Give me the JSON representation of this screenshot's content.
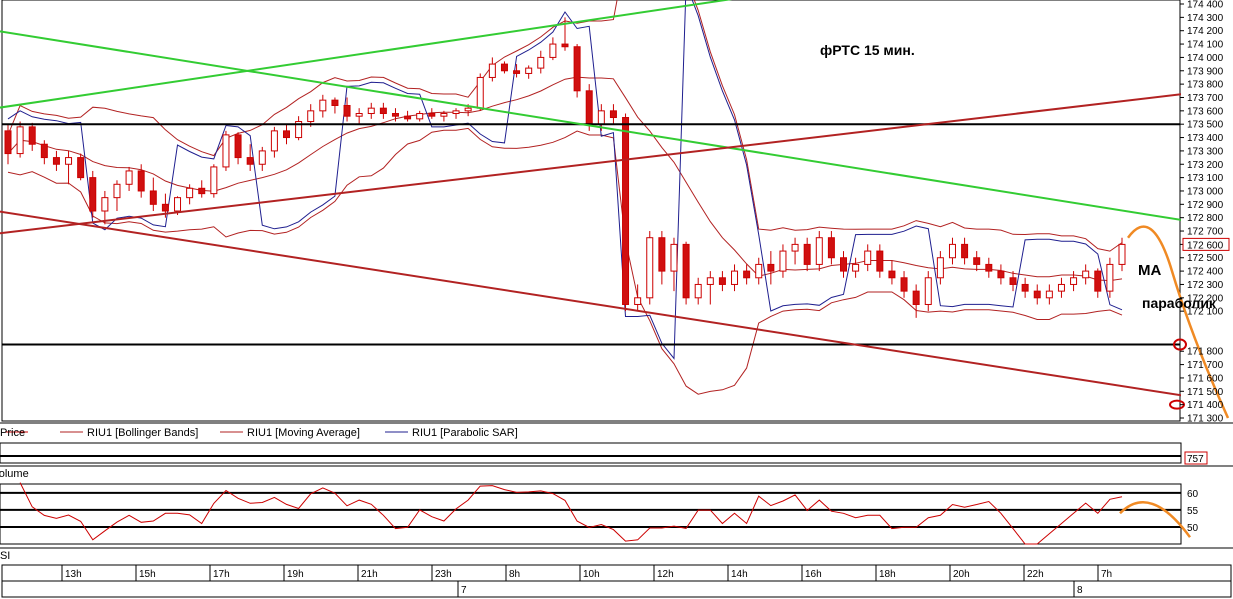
{
  "chart_data": {
    "type": "candlestick",
    "title": "фРТС   15 мин.",
    "annotations": [
      "МА",
      "параболик"
    ],
    "price_axis": {
      "ylim": [
        171300,
        174400
      ],
      "ticks": [
        "174 400",
        "174 300",
        "174 200",
        "174 100",
        "174 000",
        "173 900",
        "173 800",
        "173 700",
        "173 600",
        "173 500",
        "173 400",
        "173 300",
        "173 200",
        "173 100",
        "173 000",
        "172 900",
        "172 800",
        "172 700",
        "172 600",
        "172 500",
        "172 400",
        "172 300",
        "172 200",
        "172 100",
        "171 800",
        "171 700",
        "171 600",
        "171 500",
        "171 400",
        "171 300"
      ],
      "last_price": "172 600"
    },
    "time_axis": {
      "hour_labels": [
        "13h",
        "15h",
        "17h",
        "19h",
        "21h",
        "23h",
        "8h",
        "10h",
        "12h",
        "14h",
        "16h",
        "18h",
        "20h",
        "22h",
        "7h"
      ],
      "day_labels": [
        "7",
        "8"
      ]
    },
    "legend": [
      {
        "label": "Price",
        "color": "#cc0000"
      },
      {
        "label": "RIU1 [Bollinger Bands]",
        "color": "#b22222"
      },
      {
        "label": "RIU1 [Moving Average]",
        "color": "#b22222"
      },
      {
        "label": "RIU1 [Parabolic SAR]",
        "color": "#1f1f8f"
      }
    ],
    "volume_panel": {
      "label": "Volume",
      "value": "757"
    },
    "rsi_panel": {
      "label": "RSI",
      "ticks": [
        "60",
        "55",
        "50"
      ]
    },
    "horizontal_levels": [
      173500,
      171850
    ],
    "series": [
      {
        "name": "Price",
        "values": [
          [
            173450,
            173500,
            173200,
            173280
          ],
          [
            173280,
            173520,
            173250,
            173480
          ],
          [
            173480,
            173510,
            173300,
            173350
          ],
          [
            173350,
            173380,
            173200,
            173250
          ],
          [
            173250,
            173300,
            173150,
            173200
          ],
          [
            173200,
            173300,
            173050,
            173250
          ],
          [
            173250,
            173280,
            173080,
            173100
          ],
          [
            173100,
            173150,
            172800,
            172850
          ],
          [
            172850,
            173000,
            172750,
            172950
          ],
          [
            172950,
            173080,
            172850,
            173050
          ],
          [
            173050,
            173180,
            173000,
            173150
          ],
          [
            173150,
            173200,
            172950,
            173000
          ],
          [
            173000,
            173100,
            172850,
            172900
          ],
          [
            172900,
            172980,
            172800,
            172850
          ],
          [
            172850,
            172960,
            172820,
            172950
          ],
          [
            172950,
            173050,
            172900,
            173020
          ],
          [
            173020,
            173080,
            172950,
            172980
          ],
          [
            172980,
            173200,
            172950,
            173180
          ],
          [
            173180,
            173450,
            173150,
            173420
          ],
          [
            173420,
            173440,
            173200,
            173250
          ],
          [
            173250,
            173350,
            173150,
            173200
          ],
          [
            173200,
            173330,
            173150,
            173300
          ],
          [
            173300,
            173480,
            173250,
            173450
          ],
          [
            173450,
            173500,
            173350,
            173400
          ],
          [
            173400,
            173560,
            173380,
            173520
          ],
          [
            173520,
            173650,
            173480,
            173600
          ],
          [
            173600,
            173720,
            173550,
            173680
          ],
          [
            173680,
            173700,
            173580,
            173640
          ],
          [
            173640,
            173700,
            173520,
            173560
          ],
          [
            173560,
            173620,
            173500,
            173580
          ],
          [
            173580,
            173660,
            173540,
            173620
          ],
          [
            173620,
            173660,
            173540,
            173580
          ],
          [
            173580,
            173620,
            173520,
            173560
          ],
          [
            173560,
            173600,
            173520,
            173540
          ],
          [
            173540,
            173600,
            173520,
            173580
          ],
          [
            173580,
            173620,
            173540,
            173560
          ],
          [
            173560,
            173600,
            173520,
            173580
          ],
          [
            173580,
            173620,
            173540,
            173600
          ],
          [
            173600,
            173650,
            173560,
            173620
          ],
          [
            173620,
            173880,
            173600,
            173850
          ],
          [
            173850,
            174000,
            173820,
            173950
          ],
          [
            173950,
            173970,
            173880,
            173900
          ],
          [
            173900,
            173950,
            173850,
            173880
          ],
          [
            173880,
            173940,
            173840,
            173920
          ],
          [
            173920,
            174050,
            173880,
            174000
          ],
          [
            174000,
            174150,
            173980,
            174100
          ],
          [
            174100,
            174300,
            174050,
            174080
          ],
          [
            174080,
            174100,
            173700,
            173750
          ],
          [
            173750,
            173800,
            173450,
            173500
          ],
          [
            173500,
            173650,
            173450,
            173600
          ],
          [
            173600,
            173650,
            173500,
            173550
          ],
          [
            173550,
            173580,
            172100,
            172150
          ],
          [
            172150,
            172300,
            172100,
            172200
          ],
          [
            172200,
            172700,
            172150,
            172650
          ],
          [
            172650,
            172700,
            172300,
            172400
          ],
          [
            172400,
            172650,
            172250,
            172600
          ],
          [
            172600,
            172620,
            172150,
            172200
          ],
          [
            172200,
            172350,
            172150,
            172300
          ],
          [
            172300,
            172400,
            172150,
            172350
          ],
          [
            172350,
            172400,
            172250,
            172300
          ],
          [
            172300,
            172450,
            172250,
            172400
          ],
          [
            172400,
            172450,
            172300,
            172350
          ],
          [
            172350,
            172500,
            172300,
            172450
          ],
          [
            172450,
            172550,
            172300,
            172400
          ],
          [
            172400,
            172600,
            172350,
            172550
          ],
          [
            172550,
            172650,
            172450,
            172600
          ],
          [
            172600,
            172650,
            172400,
            172450
          ],
          [
            172450,
            172700,
            172400,
            172650
          ],
          [
            172650,
            172700,
            172450,
            172500
          ],
          [
            172500,
            172550,
            172350,
            172400
          ],
          [
            172400,
            172500,
            172350,
            172450
          ],
          [
            172450,
            172600,
            172400,
            172550
          ],
          [
            172550,
            172600,
            172350,
            172400
          ],
          [
            172400,
            172480,
            172300,
            172350
          ],
          [
            172350,
            172400,
            172200,
            172250
          ],
          [
            172250,
            172300,
            172050,
            172150
          ],
          [
            172150,
            172400,
            172100,
            172350
          ],
          [
            172350,
            172550,
            172300,
            172500
          ],
          [
            172500,
            172650,
            172450,
            172600
          ],
          [
            172600,
            172650,
            172450,
            172500
          ],
          [
            172500,
            172550,
            172400,
            172450
          ],
          [
            172450,
            172500,
            172350,
            172400
          ],
          [
            172400,
            172450,
            172300,
            172350
          ],
          [
            172350,
            172400,
            172250,
            172300
          ],
          [
            172300,
            172350,
            172200,
            172250
          ],
          [
            172250,
            172300,
            172150,
            172200
          ],
          [
            172200,
            172300,
            172150,
            172250
          ],
          [
            172250,
            172350,
            172200,
            172300
          ],
          [
            172300,
            172400,
            172250,
            172350
          ],
          [
            172350,
            172450,
            172300,
            172400
          ],
          [
            172400,
            172420,
            172200,
            172250
          ],
          [
            172250,
            172500,
            172200,
            172450
          ],
          [
            172450,
            172650,
            172400,
            172600
          ]
        ]
      }
    ]
  }
}
